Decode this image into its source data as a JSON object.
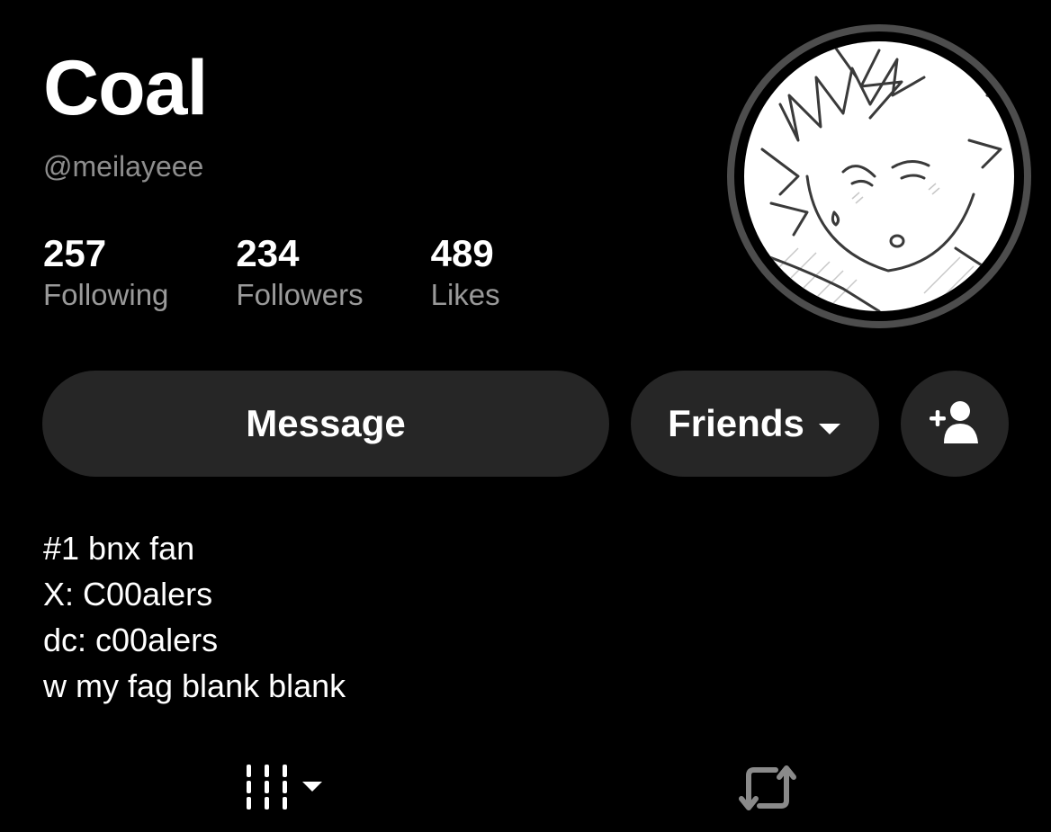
{
  "profile": {
    "display_name": "Coal",
    "handle": "@meilayeee"
  },
  "stats": [
    {
      "count": "257",
      "label": "Following"
    },
    {
      "count": "234",
      "label": "Followers"
    },
    {
      "count": "489",
      "label": "Likes"
    }
  ],
  "actions": {
    "message_label": "Message",
    "friends_label": "Friends",
    "add_friend_icon": "add-person-icon",
    "dropdown_icon": "caret-down-icon"
  },
  "bio": [
    "#1 bnx fan",
    "X: C00alers",
    "dc: c00alers",
    "w my fag blank blank"
  ],
  "tabs": [
    {
      "icon": "grid-icon"
    },
    {
      "icon": "repost-icon"
    }
  ],
  "colors": {
    "background": "#000000",
    "button": "#262626",
    "muted_text": "#8e8e8e",
    "avatar_ring": "#4d4d4d"
  }
}
